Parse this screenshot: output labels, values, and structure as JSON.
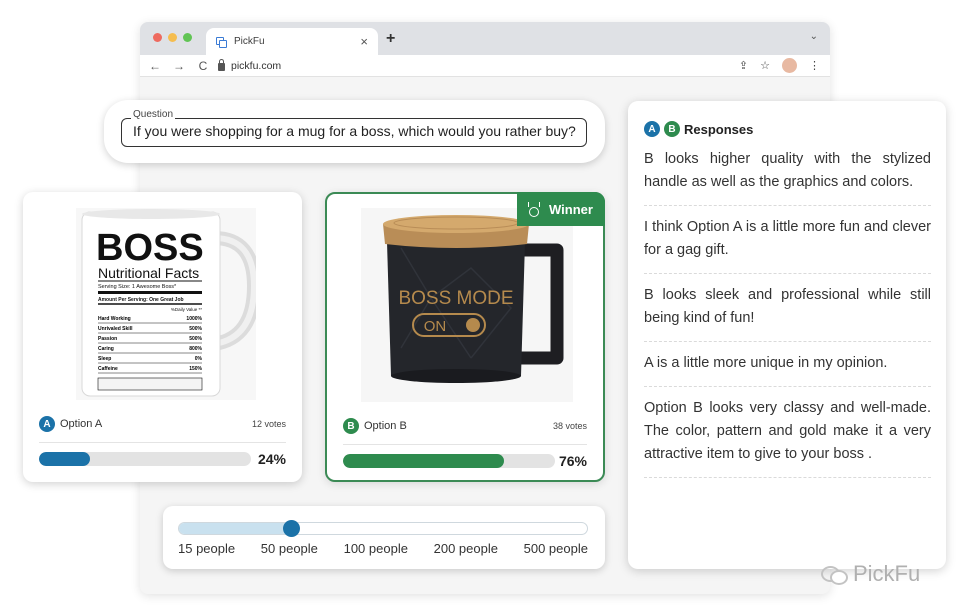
{
  "browser": {
    "tab_title": "PickFu",
    "url": "pickfu.com",
    "new_tab": "+",
    "close_tab": "×",
    "chevron": "⌄",
    "nav": {
      "back": "←",
      "forward": "→",
      "reload": "C"
    },
    "share": "⇪",
    "star": "☆",
    "menu": "⋮",
    "traffic_light_colors": [
      "#ee6a5f",
      "#f5bd4f",
      "#61c454"
    ]
  },
  "question": {
    "legend": "Question",
    "text": "If you were shopping for a mug for a boss, which would you rather buy?"
  },
  "options": [
    {
      "badge": "A",
      "label": "Option A",
      "votes": "12 votes",
      "percent_text": "24%",
      "percent": 24,
      "color": "#1b72a8",
      "image": {
        "title": "BOSS",
        "subtitle": "Nutritional Facts",
        "serving": "Serving Size: 1 Awesome Boss*",
        "amount": "Amount Per Serving: One Great Job",
        "daily": "%Daily Value **",
        "rows": [
          [
            "Hard Working",
            "1000%"
          ],
          [
            "Unrivaled Skill",
            "500%"
          ],
          [
            "Passion",
            "500%"
          ],
          [
            "Caring",
            "800%"
          ],
          [
            "Sleep",
            "0%"
          ],
          [
            "Caffeine",
            "150%"
          ]
        ]
      }
    },
    {
      "badge": "B",
      "label": "Option B",
      "votes": "38 votes",
      "percent_text": "76%",
      "percent": 76,
      "color": "#2e8b4e",
      "winner_label": "Winner",
      "image": {
        "line1": "BOSS MODE",
        "line2": "ON"
      }
    }
  ],
  "audience": {
    "ticks": [
      "15 people",
      "50 people",
      "100 people",
      "200 people",
      "500 people"
    ],
    "selected": "50 people",
    "selected_index": 1
  },
  "responses": {
    "title": "Responses",
    "badges": [
      "A",
      "B"
    ],
    "items": [
      "B looks higher quality with the stylized handle as well as the graphics and colors.",
      "I think Option A is a little more fun and clever for a gag gift.",
      "B looks sleek and professional while still being kind of fun!",
      "A is a little more unique in my opinion.",
      "Option B looks very classy and well-made. The color, pattern and gold make it a very attractive item to give to your boss ."
    ]
  },
  "watermark": "PickFu"
}
